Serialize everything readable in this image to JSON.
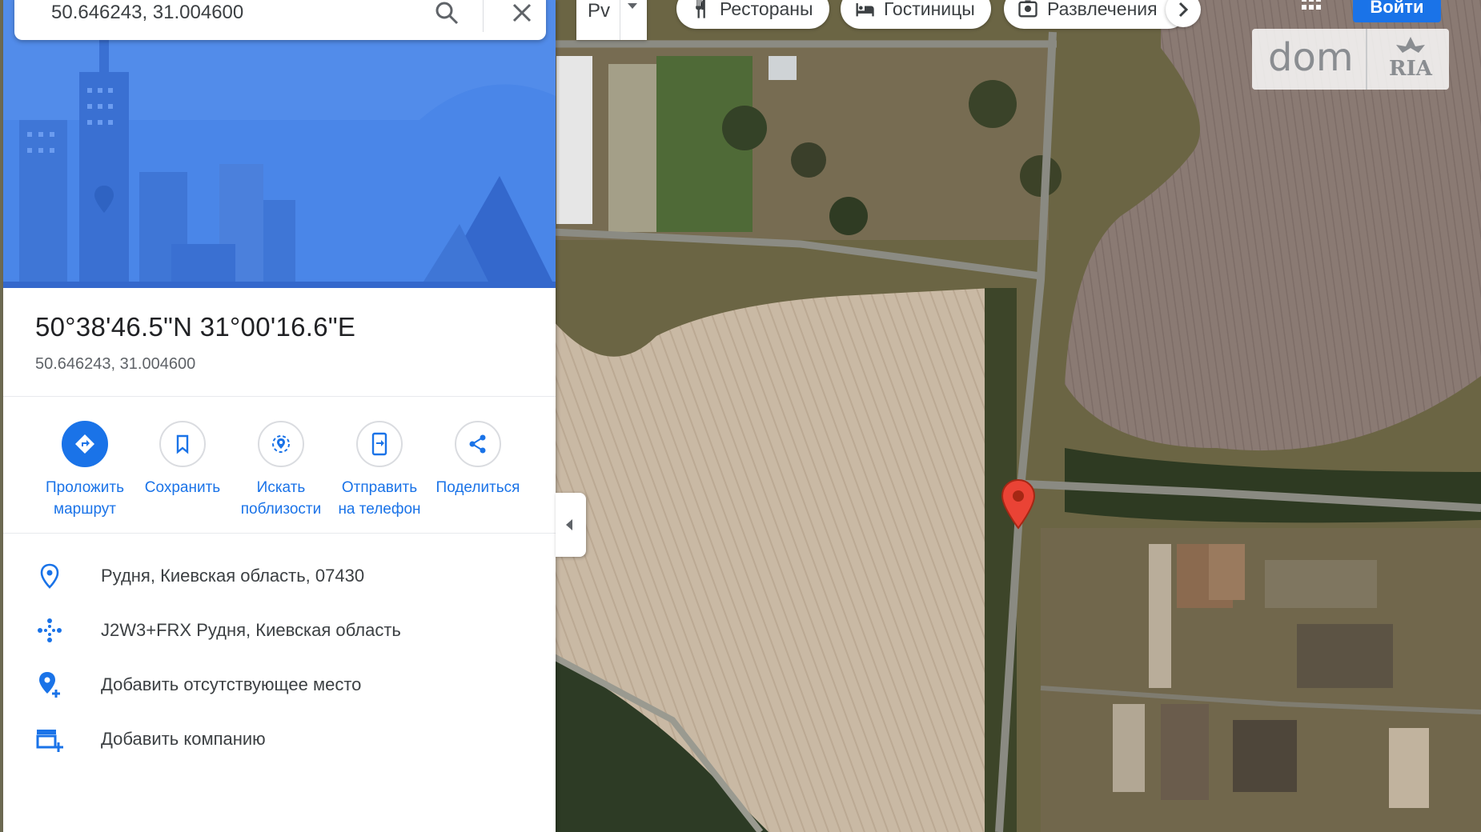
{
  "search": {
    "value": "50.646243, 31.004600"
  },
  "place": {
    "coords_dms": "50°38'46.5\"N 31°00'16.6\"E",
    "coords_decimal": "50.646243, 31.004600"
  },
  "actions": [
    {
      "label_line1": "Проложить",
      "label_line2": "маршрут",
      "icon": "directions-icon"
    },
    {
      "label_line1": "Сохранить",
      "label_line2": "",
      "icon": "bookmark-icon"
    },
    {
      "label_line1": "Искать",
      "label_line2": "поблизости",
      "icon": "nearby-icon"
    },
    {
      "label_line1": "Отправить",
      "label_line2": "на телефон",
      "icon": "send-to-phone-icon"
    },
    {
      "label_line1": "Поделиться",
      "label_line2": "",
      "icon": "share-icon"
    }
  ],
  "info": [
    {
      "text": "Рудня, Киевская область, 07430",
      "icon": "location-pin-icon"
    },
    {
      "text": "J2W3+FRX Рудня, Киевская область",
      "icon": "plus-code-icon"
    },
    {
      "text": "Добавить отсутствующее место",
      "icon": "add-place-icon"
    },
    {
      "text": "Добавить компанию",
      "icon": "add-business-icon"
    }
  ],
  "map_controls": {
    "layer_value": "Рv",
    "chips": [
      {
        "label": "Рестораны",
        "icon": "restaurant-icon"
      },
      {
        "label": "Гостиницы",
        "icon": "hotel-icon"
      },
      {
        "label": "Развлечения",
        "icon": "entertainment-icon"
      }
    ],
    "signin_label": "Войти"
  },
  "watermark": {
    "brand_left": "dom",
    "brand_right": "RIA"
  },
  "colors": {
    "accent": "#1a73e8",
    "pin": "#ea4335",
    "hero_bg": "#4a86e8"
  }
}
